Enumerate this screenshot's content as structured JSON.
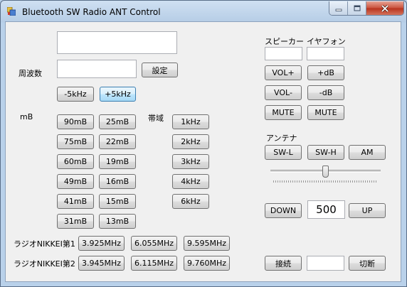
{
  "window": {
    "title": "Bluetooth SW Radio ANT Control"
  },
  "icons": {
    "app": "app-icon",
    "min": "minimize-icon",
    "max": "maximize-icon",
    "close": "close-icon"
  },
  "frequency": {
    "label": "周波数",
    "set_button": "設定",
    "top_value": "",
    "input_value": "",
    "minus_button": "-5kHz",
    "plus_button": "+5kHz"
  },
  "meter_bands": {
    "label": "mB",
    "buttons": [
      "90mB",
      "25mB",
      "75mB",
      "22mB",
      "60mB",
      "19mB",
      "49mB",
      "16mB",
      "41mB",
      "15mB",
      "31mB",
      "13mB"
    ]
  },
  "bandwidth": {
    "label": "帯域",
    "buttons": [
      "1kHz",
      "2kHz",
      "3kHz",
      "4kHz",
      "6kHz"
    ]
  },
  "presets": [
    {
      "label": "ラジオNIKKEI第1",
      "buttons": [
        "3.925MHz",
        "6.055MHz",
        "9.595MHz"
      ]
    },
    {
      "label": "ラジオNIKKEI第2",
      "buttons": [
        "3.945MHz",
        "6.115MHz",
        "9.760MHz"
      ]
    }
  ],
  "audio": {
    "speaker_label": "スピーカー",
    "earphone_label": "イヤフォン",
    "speaker_value": "",
    "earphone_value": "",
    "vol_up": "VOL+",
    "db_up": "+dB",
    "vol_down": "VOL-",
    "db_down": "-dB",
    "mute_speaker": "MUTE",
    "mute_earphone": "MUTE"
  },
  "antenna": {
    "label": "アンテナ",
    "buttons": [
      "SW-L",
      "SW-H",
      "AM"
    ],
    "slider_level": 0.5
  },
  "tuner": {
    "down": "DOWN",
    "value": "500",
    "up": "UP"
  },
  "connection": {
    "connect": "接続",
    "status_value": "",
    "disconnect": "切断"
  },
  "colors": {
    "title_bar": "#b9d1ea",
    "close_button": "#c9503a",
    "client_bg": "#f0f0f0"
  }
}
